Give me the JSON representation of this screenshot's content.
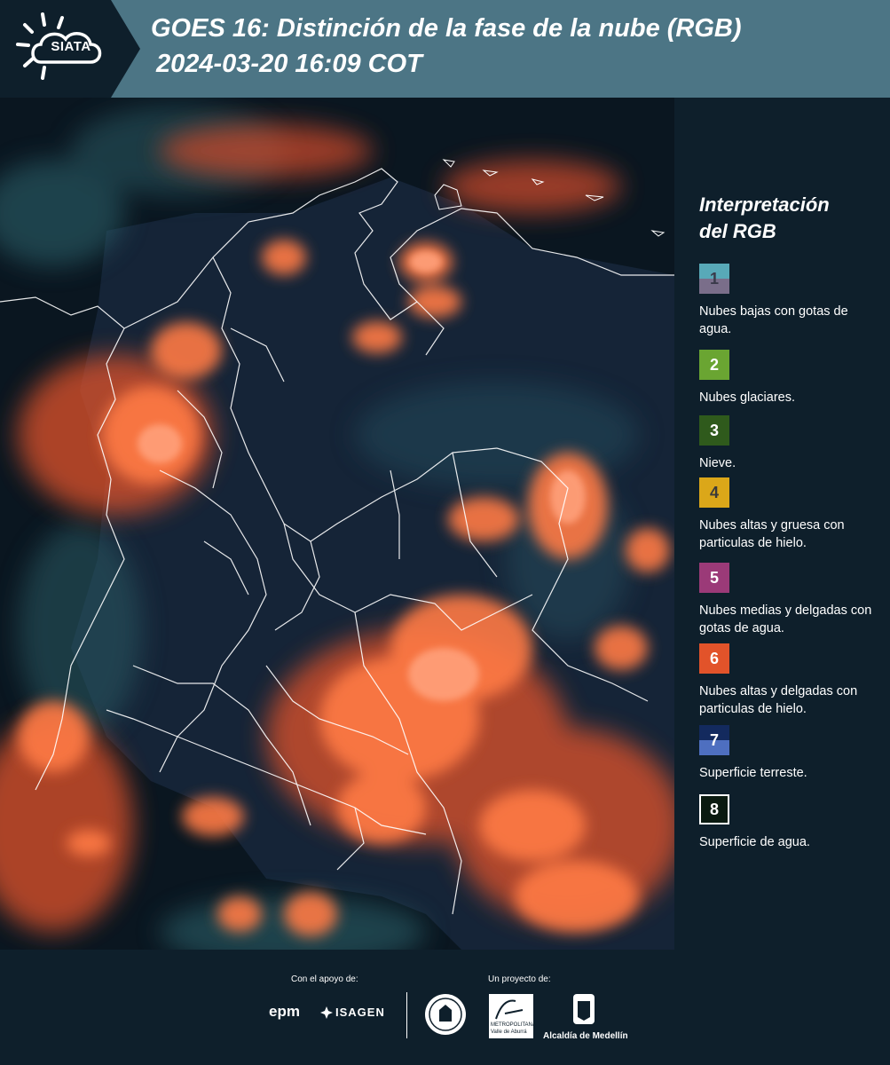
{
  "header": {
    "logo_text": "SIATA",
    "title_line1": "GOES 16: Distinción de la fase de la nube (RGB)",
    "title_line2": "2024-03-20 16:09 COT"
  },
  "legend": {
    "title_line1": "Interpretación",
    "title_line2": "del RGB",
    "items": [
      {
        "number": "1",
        "label": "Nubes bajas con gotas de agua.",
        "color_top": "#58a9b8",
        "color_bottom": "#7a6e8a",
        "number_color": "#3a3a4a"
      },
      {
        "number": "2",
        "label": "Nubes glaciares.",
        "color_top": "#6aa532",
        "color_bottom": "#6aa532",
        "number_color": "#ffffff"
      },
      {
        "number": "3",
        "label": "Nieve.",
        "color_top": "#2f5a1c",
        "color_bottom": "#2f5a1c",
        "number_color": "#ffffff"
      },
      {
        "number": "4",
        "label": "Nubes altas y gruesa con particulas de hielo.",
        "color_top": "#dba719",
        "color_bottom": "#dba719",
        "number_color": "#3a3a3a"
      },
      {
        "number": "5",
        "label": "Nubes medias y delgadas con gotas de agua.",
        "color_top": "#9b3a78",
        "color_bottom": "#9b3a78",
        "number_color": "#ffffff"
      },
      {
        "number": "6",
        "label": "Nubes altas y delgadas con particulas de hielo.",
        "color_top": "#e2532a",
        "color_bottom": "#e2532a",
        "number_color": "#ffffff"
      },
      {
        "number": "7",
        "label": "Superficie terreste.",
        "color_top": "#132a5e",
        "color_bottom": "#4e6fc0",
        "number_color": "#ffffff"
      },
      {
        "number": "8",
        "label": "Superficie de agua.",
        "color_top": "#0a1a10",
        "color_bottom": "#0a1a10",
        "number_color": "#ffffff"
      }
    ]
  },
  "footer": {
    "support_label": "Con el apoyo de:",
    "project_label": "Un proyecto de:",
    "epm_logo": "epm",
    "isagen_logo": "ISAGEN",
    "metro_logo_line1": "METROPOLITANA",
    "metro_logo_line2": "Valle de Aburrá",
    "alcaldia_logo": "Alcaldía de Medellín"
  },
  "colors": {
    "header_bg": "#4c7585",
    "panel_bg": "#0e1f2b",
    "cloud_orange": "#ff6a3a",
    "cloud_core": "#ff9166"
  }
}
